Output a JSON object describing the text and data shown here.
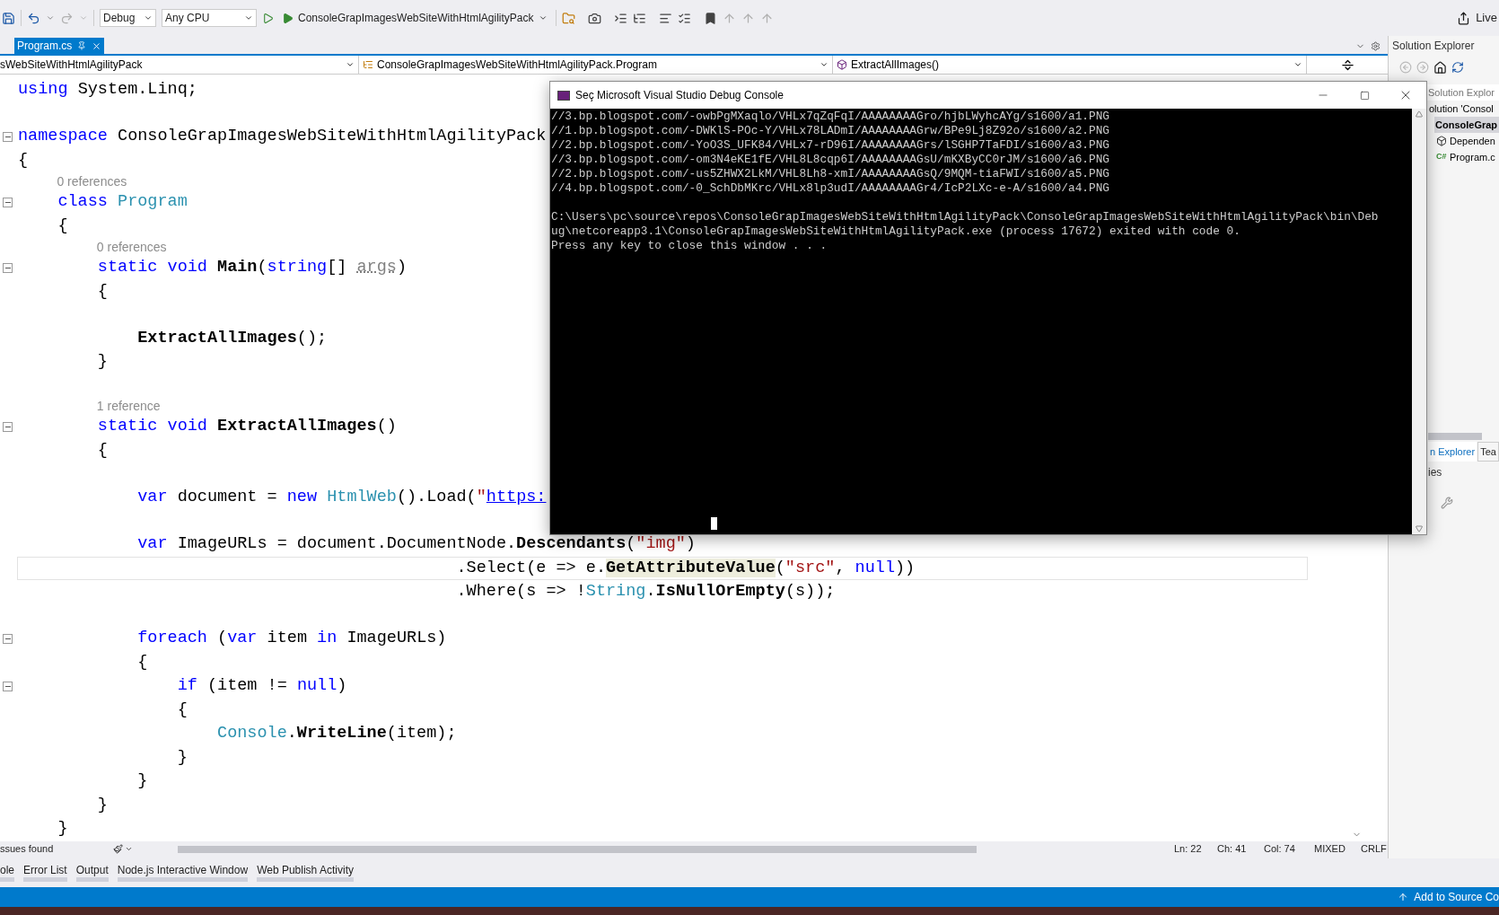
{
  "toolbar": {
    "configuration": "Debug",
    "platform": "Any CPU",
    "start_target": "ConsoleGrapImagesWebSiteWithHtmlAgilityPack",
    "live_share": "Live"
  },
  "editor_tabs": [
    {
      "label": "Program.cs",
      "selected": true
    }
  ],
  "nav_bar": {
    "project": "sWebSiteWithHtmlAgilityPack",
    "type": "ConsoleGrapImagesWebSiteWithHtmlAgilityPack.Program",
    "member": "ExtractAllImages()"
  },
  "code_lines": [
    {
      "kind": "code",
      "fold": false,
      "current": false,
      "tokens": [
        {
          "t": "using ",
          "kind": "kw"
        },
        {
          "t": "System.Linq;",
          "kind": "plain"
        }
      ]
    },
    {
      "kind": "blank"
    },
    {
      "kind": "code",
      "fold": true,
      "current": false,
      "tokens": [
        {
          "t": "namespace ",
          "kind": "kw"
        },
        {
          "t": "ConsoleGrapImagesWebSiteWithHtmlAgilityPack",
          "kind": "plain"
        }
      ]
    },
    {
      "kind": "code",
      "fold": false,
      "current": false,
      "tokens": [
        {
          "t": "{",
          "kind": "plain"
        }
      ]
    },
    {
      "kind": "ref",
      "text": "0 references"
    },
    {
      "kind": "code",
      "fold": true,
      "current": false,
      "tokens": [
        {
          "t": "    class ",
          "kind": "kw"
        },
        {
          "t": "Program",
          "kind": "type"
        }
      ]
    },
    {
      "kind": "code",
      "fold": false,
      "current": false,
      "tokens": [
        {
          "t": "    {",
          "kind": "plain"
        }
      ]
    },
    {
      "kind": "ref",
      "text": "0 references"
    },
    {
      "kind": "code",
      "fold": true,
      "current": false,
      "tokens": [
        {
          "t": "        static void ",
          "kind": "kw"
        },
        {
          "t": "Main",
          "kind": "method"
        },
        {
          "t": "(",
          "kind": "plain"
        },
        {
          "t": "string",
          "kind": "kw"
        },
        {
          "t": "[] ",
          "kind": "plain"
        },
        {
          "t": "args",
          "kind": "faded"
        },
        {
          "t": ")",
          "kind": "plain"
        }
      ]
    },
    {
      "kind": "code",
      "fold": false,
      "current": false,
      "tokens": [
        {
          "t": "        {",
          "kind": "plain"
        }
      ]
    },
    {
      "kind": "blank"
    },
    {
      "kind": "code",
      "fold": false,
      "current": false,
      "tokens": [
        {
          "t": "            ExtractAllImages",
          "kind": "method"
        },
        {
          "t": "();",
          "kind": "plain"
        }
      ]
    },
    {
      "kind": "code",
      "fold": false,
      "current": false,
      "tokens": [
        {
          "t": "        }",
          "kind": "plain"
        }
      ]
    },
    {
      "kind": "blank"
    },
    {
      "kind": "ref",
      "text": "1 reference"
    },
    {
      "kind": "code",
      "fold": true,
      "current": false,
      "tokens": [
        {
          "t": "        static void ",
          "kind": "kw"
        },
        {
          "t": "ExtractAllImages",
          "kind": "method"
        },
        {
          "t": "()",
          "kind": "plain"
        }
      ]
    },
    {
      "kind": "code",
      "fold": false,
      "current": false,
      "tokens": [
        {
          "t": "        {",
          "kind": "plain"
        }
      ]
    },
    {
      "kind": "blank"
    },
    {
      "kind": "code",
      "fold": false,
      "current": false,
      "tokens": [
        {
          "t": "            var",
          "kind": "kw"
        },
        {
          "t": " document = ",
          "kind": "plain"
        },
        {
          "t": "new ",
          "kind": "kw"
        },
        {
          "t": "HtmlWeb",
          "kind": "type"
        },
        {
          "t": "().Load(",
          "kind": "plain"
        },
        {
          "t": "\"",
          "kind": "str"
        },
        {
          "t": "https:",
          "kind": "link"
        }
      ]
    },
    {
      "kind": "blank"
    },
    {
      "kind": "code",
      "fold": false,
      "current": false,
      "tokens": [
        {
          "t": "            var",
          "kind": "kw"
        },
        {
          "t": " ImageURLs = document.DocumentNode.",
          "kind": "plain"
        },
        {
          "t": "Descendants",
          "kind": "method"
        },
        {
          "t": "(",
          "kind": "plain"
        },
        {
          "t": "\"img\"",
          "kind": "str"
        },
        {
          "t": ")",
          "kind": "plain"
        }
      ]
    },
    {
      "kind": "code",
      "fold": false,
      "current": true,
      "tokens": [
        {
          "t": "                                            .Select(e => e.",
          "kind": "plain"
        },
        {
          "t": "GetAttributeValue",
          "kind": "hl"
        },
        {
          "t": "(",
          "kind": "plain"
        },
        {
          "t": "\"src\"",
          "kind": "str"
        },
        {
          "t": ", ",
          "kind": "plain"
        },
        {
          "t": "null",
          "kind": "kw"
        },
        {
          "t": "))",
          "kind": "plain"
        }
      ]
    },
    {
      "kind": "code",
      "fold": false,
      "current": false,
      "tokens": [
        {
          "t": "                                            .Where(s => !",
          "kind": "plain"
        },
        {
          "t": "String",
          "kind": "type"
        },
        {
          "t": ".",
          "kind": "plain"
        },
        {
          "t": "IsNullOrEmpty",
          "kind": "method"
        },
        {
          "t": "(s));",
          "kind": "plain"
        }
      ]
    },
    {
      "kind": "blank"
    },
    {
      "kind": "code",
      "fold": true,
      "current": false,
      "tokens": [
        {
          "t": "            foreach",
          "kind": "kw"
        },
        {
          "t": " (",
          "kind": "plain"
        },
        {
          "t": "var",
          "kind": "kw"
        },
        {
          "t": " item ",
          "kind": "plain"
        },
        {
          "t": "in",
          "kind": "kw"
        },
        {
          "t": " ImageURLs)",
          "kind": "plain"
        }
      ]
    },
    {
      "kind": "code",
      "fold": false,
      "current": false,
      "tokens": [
        {
          "t": "            {",
          "kind": "plain"
        }
      ]
    },
    {
      "kind": "code",
      "fold": true,
      "current": false,
      "tokens": [
        {
          "t": "                if",
          "kind": "kw"
        },
        {
          "t": " (item != ",
          "kind": "plain"
        },
        {
          "t": "null",
          "kind": "kw"
        },
        {
          "t": ")",
          "kind": "plain"
        }
      ]
    },
    {
      "kind": "code",
      "fold": false,
      "current": false,
      "tokens": [
        {
          "t": "                {",
          "kind": "plain"
        }
      ]
    },
    {
      "kind": "code",
      "fold": false,
      "current": false,
      "tokens": [
        {
          "t": "                    Console",
          "kind": "type"
        },
        {
          "t": ".",
          "kind": "plain"
        },
        {
          "t": "WriteLine",
          "kind": "method"
        },
        {
          "t": "(item);",
          "kind": "plain"
        }
      ]
    },
    {
      "kind": "code",
      "fold": false,
      "current": false,
      "tokens": [
        {
          "t": "                }",
          "kind": "plain"
        }
      ]
    },
    {
      "kind": "code",
      "fold": false,
      "current": false,
      "tokens": [
        {
          "t": "            }",
          "kind": "plain"
        }
      ]
    },
    {
      "kind": "code",
      "fold": false,
      "current": false,
      "tokens": [
        {
          "t": "        }",
          "kind": "plain"
        }
      ]
    },
    {
      "kind": "code",
      "fold": false,
      "current": false,
      "tokens": [
        {
          "t": "    }",
          "kind": "plain"
        }
      ]
    }
  ],
  "editor_status": {
    "issues": "ssues found",
    "line": "Ln: 22",
    "char": "Ch: 41",
    "col": "Col: 74",
    "whitespace": "MIXED",
    "line_ending": "CRLF"
  },
  "solution_explorer": {
    "title": "Solution Explorer",
    "search_placeholder": "Solution Explor",
    "tree": [
      {
        "label": "olution 'Consol",
        "selected": false,
        "children": [
          {
            "label": "ConsoleGrap",
            "selected": true,
            "children": [
              {
                "label": "Dependen",
                "kind": "dependencies",
                "selected": false
              },
              {
                "label": "Program.c",
                "kind": "file",
                "icon_text": "C#",
                "selected": false
              }
            ]
          }
        ]
      }
    ],
    "tabs": [
      {
        "label": "n Explorer",
        "selected": true
      },
      {
        "label": "Tea",
        "selected": false
      }
    ],
    "properties_title": "ies"
  },
  "console": {
    "title": "Seç Microsoft Visual Studio Debug Console",
    "output_lines": [
      "//3.bp.blogspot.com/-owbPgMXaqlo/VHLx7qZqFqI/AAAAAAAAGro/hjbLWyhcAYg/s1600/a1.PNG",
      "//1.bp.blogspot.com/-DWKlS-POc-Y/VHLx78LADmI/AAAAAAAAGrw/BPe9Lj8Z92o/s1600/a2.PNG",
      "//2.bp.blogspot.com/-YoO3S_UFK84/VHLx7-rD96I/AAAAAAAAGrs/lSGHP7TaFDI/s1600/a3.PNG",
      "//3.bp.blogspot.com/-om3N4eKE1fE/VHL8L8cqp6I/AAAAAAAAGsU/mKXByCC0rJM/s1600/a6.PNG",
      "//2.bp.blogspot.com/-us5ZHWX2LkM/VHL8Lh8-xmI/AAAAAAAAGsQ/9MQM-tiaFWI/s1600/a5.PNG",
      "//4.bp.blogspot.com/-0_SchDbMKrc/VHLx8lp3udI/AAAAAAAAGr4/IcP2LXc-e-A/s1600/a4.PNG"
    ],
    "exit_lines": [
      "C:\\Users\\pc\\source\\repos\\ConsoleGrapImagesWebSiteWithHtmlAgilityPack\\ConsoleGrapImagesWebSiteWithHtmlAgilityPack\\bin\\Deb",
      "ug\\netcoreapp3.1\\ConsoleGrapImagesWebSiteWithHtmlAgilityPack.exe (process 17672) exited with code 0.",
      "Press any key to close this window . . ."
    ]
  },
  "tool_tabs": [
    "ole",
    "Error List",
    "Output",
    "Node.js Interactive Window",
    "Web Publish Activity"
  ],
  "status_bar": {
    "source_control": "Add to Source Co"
  }
}
